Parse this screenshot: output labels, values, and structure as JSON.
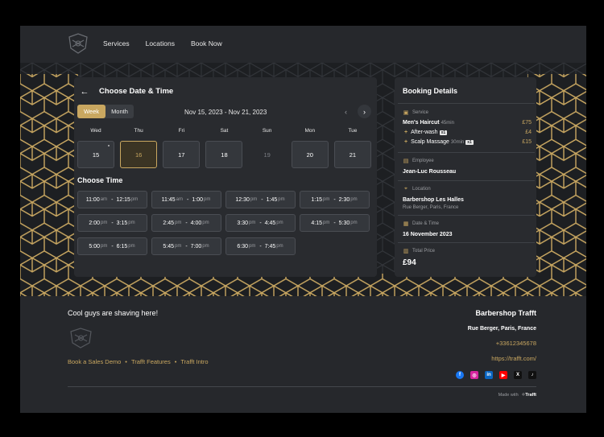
{
  "nav": [
    "Services",
    "Locations",
    "Book Now"
  ],
  "booking": {
    "title": "Choose Date & Time",
    "toggle": [
      "Week",
      "Month"
    ],
    "range": "Nov 15, 2023 - Nov 21, 2023",
    "days": [
      "Wed",
      "Thu",
      "Fri",
      "Sat",
      "Sun",
      "Mon",
      "Tue"
    ],
    "dates": [
      "15",
      "16",
      "17",
      "18",
      "19",
      "20",
      "21"
    ],
    "choose_time": "Choose Time",
    "slots": [
      {
        "s": "11:00",
        "sa": "am",
        "e": "12:15",
        "ea": "pm"
      },
      {
        "s": "11:45",
        "sa": "am",
        "e": "1:00",
        "ea": "pm"
      },
      {
        "s": "12:30",
        "sa": "pm",
        "e": "1:45",
        "ea": "pm"
      },
      {
        "s": "1:15",
        "sa": "pm",
        "e": "2:30",
        "ea": "pm"
      },
      {
        "s": "2:00",
        "sa": "pm",
        "e": "3:15",
        "ea": "pm"
      },
      {
        "s": "2:45",
        "sa": "pm",
        "e": "4:00",
        "ea": "pm"
      },
      {
        "s": "3:30",
        "sa": "pm",
        "e": "4:45",
        "ea": "pm"
      },
      {
        "s": "4:15",
        "sa": "pm",
        "e": "5:30",
        "ea": "pm"
      },
      {
        "s": "5:00",
        "sa": "pm",
        "e": "6:15",
        "ea": "pm"
      },
      {
        "s": "5:45",
        "sa": "pm",
        "e": "7:00",
        "ea": "pm"
      },
      {
        "s": "6:30",
        "sa": "pm",
        "e": "7:45",
        "ea": "pm"
      }
    ]
  },
  "details": {
    "title": "Booking Details",
    "service_label": "Service",
    "service_name": "Men's Haircut",
    "service_dur": "45min",
    "service_price": "£75",
    "addon1_name": "After-wash",
    "addon1_qty": "x1",
    "addon1_price": "£4",
    "addon2_name": "Scalp Massage",
    "addon2_dur": "30min",
    "addon2_qty": "x1",
    "addon2_price": "£15",
    "employee_label": "Employee",
    "employee": "Jean-Luc Rousseau",
    "location_label": "Location",
    "location": "Barbershop Les Halles",
    "location_addr": "Rue Berger, Paris, France",
    "datetime_label": "Date & Time",
    "datetime": "16 November 2023",
    "total_label": "Total Price",
    "total": "£94"
  },
  "footer": {
    "tagline": "Cool guys are shaving here!",
    "links": [
      "Book a Sales Demo",
      "Trafft Features",
      "Trafft Intro"
    ],
    "name": "Barbershop Trafft",
    "address": "Rue Berger, Paris, France",
    "phone": "+33612345678",
    "url": "https://trafft.com/",
    "made_with": "Made with",
    "brand": "Trafft"
  },
  "colors": {
    "accent": "#c9a760",
    "bg": "#26282c",
    "card": "#292b2f"
  }
}
